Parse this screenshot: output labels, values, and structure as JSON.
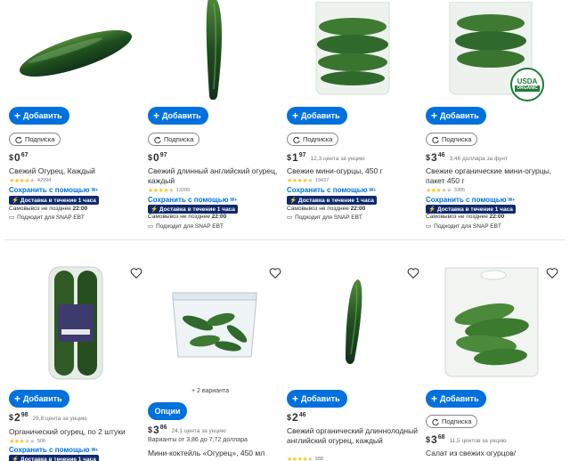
{
  "actions": {
    "add_label": "Добавить",
    "subscribe_label": "Подписка",
    "options_label": "Опции"
  },
  "badges": {
    "save_label": "Сохранить с помощью",
    "wplus": "W+",
    "delivery_label": "Доставка в течение 1 часа",
    "pickup_prefix": "Самовывоз не позднее",
    "pickup_time": "22:00",
    "snap_label": "Подходит для SNAP EBT",
    "usda_line1": "USDA",
    "usda_line2": "ORGANIC"
  },
  "colors": {
    "accent": "#0071dc",
    "delivery_bg": "#0e2a6b",
    "star": "#ffc220",
    "cucumber": "#2f6a2c"
  },
  "products": [
    {
      "currency": "$",
      "whole": "0",
      "cents": "67",
      "unit_price": "",
      "title": "Свежий Огурец, Каждый",
      "rating": 4,
      "reviews": "42994"
    },
    {
      "currency": "$",
      "whole": "0",
      "cents": "97",
      "unit_price": "",
      "title": "Свежий длинный английский огурец, каждый",
      "rating": 4,
      "reviews": "13200"
    },
    {
      "currency": "$",
      "whole": "1",
      "cents": "97",
      "unit_price": "12,3 цента за унцию",
      "title": "Свежие мини-огурцы, 450 г",
      "rating": 4,
      "reviews": "19437"
    },
    {
      "currency": "$",
      "whole": "3",
      "cents": "46",
      "unit_price": "3,46 доллара за фунт",
      "title": "Свежие органические мини-огурцы, пакет 450 г",
      "rating": 3,
      "reviews": "3305"
    },
    {
      "currency": "$",
      "whole": "2",
      "cents": "98",
      "unit_price": "29,8 цента за унцию",
      "title": "Органический огурец, по 2 штуки",
      "rating": 3,
      "reviews": "506"
    },
    {
      "currency": "$",
      "whole": "3",
      "cents": "86",
      "unit_price": "24,1 цента за унцию",
      "variants": "+ 2 варианта",
      "variant_range": "Варианты от 3,86 до 7,72 доллара",
      "title": "Мини-коктейль «Огурец», 450 мл"
    },
    {
      "currency": "$",
      "whole": "2",
      "cents": "46",
      "unit_price": "",
      "title": "Свежий органический длиннолодный английский огурец, каждый",
      "rating": 4,
      "reviews": "688"
    },
    {
      "currency": "$",
      "whole": "3",
      "cents": "68",
      "unit_price": "11,5 центов за унцию",
      "title": "Салат из свежих огурцов/"
    }
  ]
}
